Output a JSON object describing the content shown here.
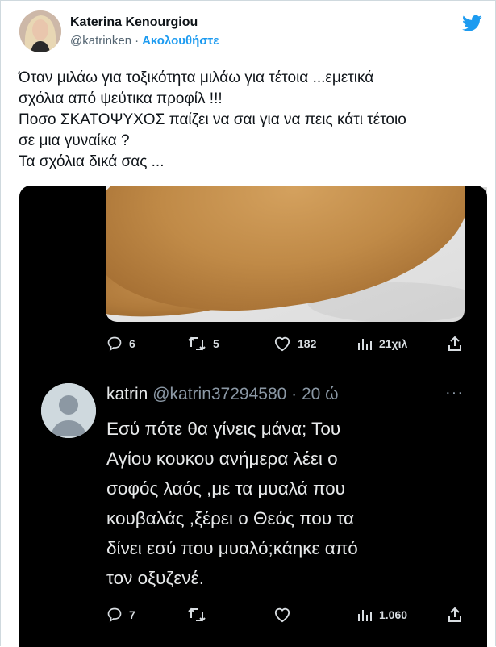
{
  "author": {
    "display_name": "Katerina Kenourgiou",
    "handle": "@katrinken",
    "separator": "·",
    "follow_label": "Ακολουθήστε"
  },
  "tweet": {
    "lines": [
      "Όταν μιλάω για τοξικότητα μιλάω για τέτοια ...εμετικά",
      "σχόλια από ψεύτικα προφίλ !!!",
      "Ποσο ΣΚΑΤΟΨΥΧΟΣ παίζει να σαι για να πεις κάτι τέτοιο",
      "σε μια γυναίκα ?",
      "Τα σχόλια δικά σας ..."
    ]
  },
  "screenshot": {
    "top_actions": {
      "replies": "6",
      "retweets": "5",
      "likes": "182",
      "views": "21χιλ"
    },
    "reply": {
      "name": "katrin",
      "handle_time": "@katrin37294580 · 20 ώ",
      "more": "···",
      "lines": [
        "Εσύ πότε θα γίνεις μάνα; Του",
        "Αγίου κουκου ανήμερα λέει ο",
        "σοφός λαός  ,με τα μυαλά που",
        "κουβαλάς ,ξέρει ο Θεός που τα",
        "δίνει εσύ που μυαλό;κάηκε από",
        "τον οξυζενέ."
      ],
      "actions": {
        "replies": "7",
        "retweets": "",
        "likes": "",
        "views": "1.060"
      }
    }
  },
  "colors": {
    "link": "#1d9bf0",
    "text": "#0f1419",
    "muted": "#536471",
    "dark_bg": "#000000"
  }
}
